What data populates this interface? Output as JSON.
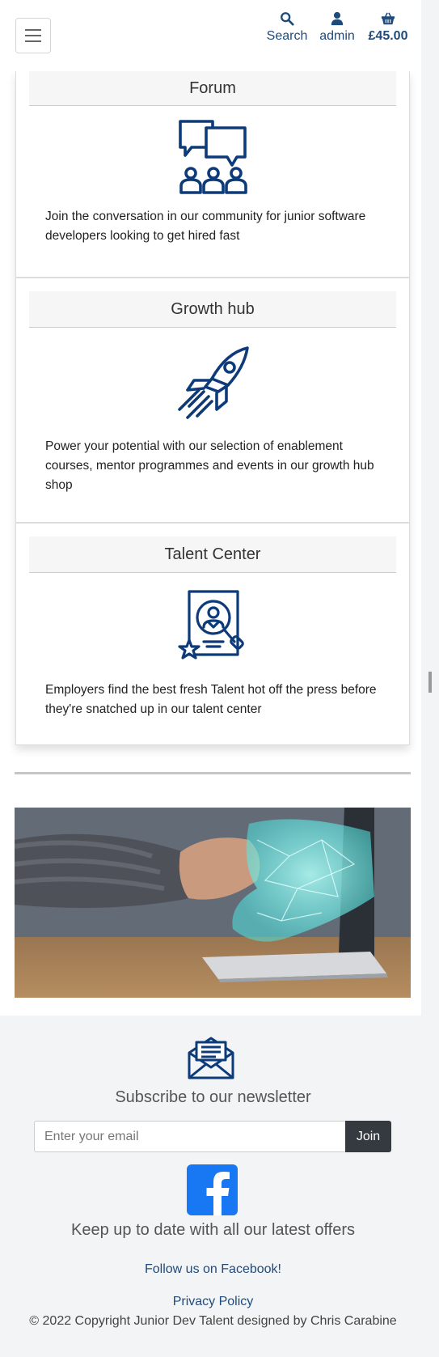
{
  "header": {
    "search_label": "Search",
    "account_label": "admin",
    "bag_total": "£45.00"
  },
  "cards": [
    {
      "title": "Forum",
      "icon": "forum-community-icon",
      "text": "Join the conversation in our community for junior software developers looking to get hired fast"
    },
    {
      "title": "Growth hub",
      "icon": "rocket-icon",
      "text": "Power your potential with our selection of enablement courses, mentor programmes and events in our growth hub shop"
    },
    {
      "title": "Talent Center",
      "icon": "candidate-profile-icon",
      "text": "Employers find the best fresh Talent hot off the press before they're snatched up in our talent center"
    }
  ],
  "footer": {
    "newsletter_title": "Subscribe to our newsletter",
    "email_placeholder": "Enter your email",
    "join_label": "Join",
    "offers_text": "Keep up to date with all our latest offers",
    "facebook_link": "Follow us on Facebook!",
    "privacy_link": "Privacy Policy",
    "copyright": "© 2022 Copyright Junior Dev Talent designed by Chris Carabine"
  },
  "colors": {
    "brand_navy": "#1f4a7c",
    "icon_blue": "#0d3b7a",
    "join_button": "#343a40",
    "facebook_blue": "#1877f2",
    "hero_glow": "#4de3e0"
  }
}
